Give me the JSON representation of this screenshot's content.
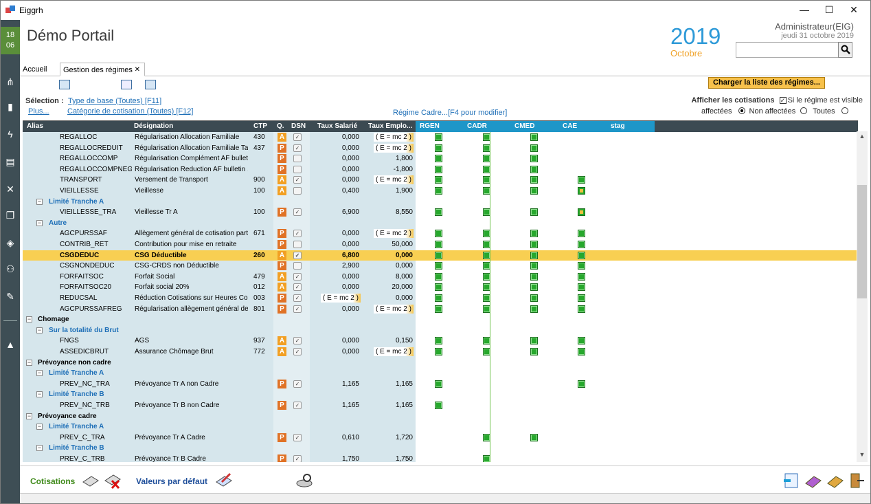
{
  "window": {
    "title": "Eiggrh",
    "minimize": "—",
    "maximize": "☐",
    "close": "✕"
  },
  "leftbar": {
    "day": "18",
    "month": "06",
    "icons": [
      "org-chart-icon",
      "user-icon",
      "flash-icon",
      "print-icon",
      "tools-icon",
      "copy-icon",
      "layers-icon",
      "group-icon",
      "edit-icon",
      "graduation-icon"
    ]
  },
  "header": {
    "app_title": "Démo Portail",
    "year": "2019",
    "month": "Octobre",
    "user": "Administrateur(EIG)",
    "date": "jeudi 31 octobre 2019",
    "search_value": ""
  },
  "tabs": {
    "home": "Accueil",
    "active": "Gestion des régimes",
    "close": "✕"
  },
  "toolbar": {
    "charger_label": "Charger la liste des régimes..."
  },
  "filters": {
    "selection_label": "Sélection :",
    "type_base": "Type de base (Toutes) [F11]",
    "plus": "Plus...",
    "categorie": "Catégorie de cotisation (Toutes) [F12]",
    "regime_cadre": "Régime Cadre...[F4 pour modifier]",
    "afficher_label": "Afficher les cotisations",
    "visible_label": "Si le régime est visible",
    "radio_affectees": "affectées",
    "radio_non": "Non affectées",
    "radio_toutes": "Toutes"
  },
  "grid": {
    "headers": {
      "alias": "Alias",
      "designation": "Désignation",
      "ctp": "CTP",
      "q": "Q.",
      "dsn": "DSN",
      "taux_sal": "Taux Salarié",
      "taux_emp": "Taux Emplo...",
      "rgen": "RGEN",
      "cadr": "CADR",
      "cmed": "CMED",
      "cae": "CAE",
      "stag": "stag"
    },
    "rows": [
      {
        "kind": "item",
        "alias": "REGALLOC",
        "desig": "Régularisation Allocation Familiale",
        "ctp": "430",
        "q": "A",
        "dsn": true,
        "ts": "0,000",
        "te": "( E = mc 2 )",
        "te_formula": true,
        "rgen": true,
        "cadr": true,
        "cmed": true,
        "cae": false
      },
      {
        "kind": "item",
        "alias": "REGALLOCREDUIT",
        "desig": "Régularisation Allocation Familiale Ta...",
        "ctp": "437",
        "q": "P",
        "dsn": true,
        "ts": "0,000",
        "te": "( E = mc 2 )",
        "te_formula": true,
        "rgen": true,
        "cadr": true,
        "cmed": true,
        "cae": false
      },
      {
        "kind": "item",
        "alias": "REGALLOCCOMP",
        "desig": "Régularisation Complément AF bulleti...",
        "ctp": "",
        "q": "P",
        "dsn": false,
        "ts": "0,000",
        "te": "1,800",
        "rgen": true,
        "cadr": true,
        "cmed": true,
        "cae": false
      },
      {
        "kind": "item",
        "alias": "REGALLOCCOMPNEG",
        "desig": "Régularisation Reduction AF bulletin ...",
        "ctp": "",
        "q": "P",
        "dsn": false,
        "ts": "0,000",
        "te": "-1,800",
        "rgen": true,
        "cadr": true,
        "cmed": true,
        "cae": false
      },
      {
        "kind": "item",
        "alias": "TRANSPORT",
        "desig": "Versement de Transport",
        "ctp": "900",
        "q": "A",
        "dsn": true,
        "ts": "0,000",
        "te": "( E = mc 2 )",
        "te_formula": true,
        "rgen": true,
        "cadr": true,
        "cmed": true,
        "cae": true
      },
      {
        "kind": "item",
        "alias": "VIEILLESSE",
        "desig": "Vieillesse",
        "ctp": "100",
        "q": "A",
        "dsn": false,
        "ts": "0,400",
        "te": "1,900",
        "rgen": true,
        "cadr": true,
        "cmed": true,
        "cae": "spec"
      },
      {
        "kind": "sub",
        "label": "Limité Tranche A"
      },
      {
        "kind": "item",
        "alias": "VIEILLESSE_TRA",
        "desig": "Vieillesse Tr A",
        "ctp": "100",
        "q": "P",
        "dsn": true,
        "ts": "6,900",
        "te": "8,550",
        "rgen": true,
        "cadr": true,
        "cmed": true,
        "cae": "spec"
      },
      {
        "kind": "sub",
        "label": "Autre"
      },
      {
        "kind": "item",
        "alias": "AGCPURSSAF",
        "desig": "Allègement général de cotisation part ...",
        "ctp": "671",
        "q": "P",
        "dsn": true,
        "ts": "0,000",
        "te": "( E = mc 2 )",
        "te_formula": true,
        "rgen": true,
        "cadr": true,
        "cmed": true,
        "cae": true
      },
      {
        "kind": "item",
        "alias": "CONTRIB_RET",
        "desig": "Contribution pour mise en retraite",
        "ctp": "",
        "q": "P",
        "dsn": false,
        "ts": "0,000",
        "te": "50,000",
        "rgen": true,
        "cadr": true,
        "cmed": true,
        "cae": true
      },
      {
        "kind": "item",
        "sel": true,
        "alias": "CSGDEDUC",
        "desig": "CSG Déductible",
        "ctp": "260",
        "q": "A",
        "dsn": true,
        "ts": "6,800",
        "te": "0,000",
        "rgen": true,
        "cadr": true,
        "cmed": true,
        "cae": true
      },
      {
        "kind": "item",
        "alias": "CSGNONDEDUC",
        "desig": "CSG-CRDS non Déductible",
        "ctp": "",
        "q": "P",
        "dsn": false,
        "ts": "2,900",
        "te": "0,000",
        "rgen": true,
        "cadr": true,
        "cmed": true,
        "cae": true
      },
      {
        "kind": "item",
        "alias": "FORFAITSOC",
        "desig": "Forfait Social",
        "ctp": "479",
        "q": "A",
        "dsn": true,
        "ts": "0,000",
        "te": "8,000",
        "rgen": true,
        "cadr": true,
        "cmed": true,
        "cae": true
      },
      {
        "kind": "item",
        "alias": "FORFAITSOC20",
        "desig": "Forfait social 20%",
        "ctp": "012",
        "q": "A",
        "dsn": true,
        "ts": "0,000",
        "te": "20,000",
        "rgen": true,
        "cadr": true,
        "cmed": true,
        "cae": true
      },
      {
        "kind": "item",
        "alias": "REDUCSAL",
        "desig": "Réduction Cotisations sur Heures Co...",
        "ctp": "003",
        "q": "P",
        "dsn": true,
        "ts": "( E = mc 2 )",
        "ts_formula": true,
        "te": "0,000",
        "rgen": true,
        "cadr": true,
        "cmed": true,
        "cae": true
      },
      {
        "kind": "item",
        "alias": "AGCPURSSAFREG",
        "desig": "Régularisation allègement général de ...",
        "ctp": "801",
        "q": "P",
        "dsn": true,
        "ts": "0,000",
        "te": "( E = mc 2 )",
        "te_formula": true,
        "rgen": true,
        "cadr": true,
        "cmed": true,
        "cae": true
      },
      {
        "kind": "grp",
        "label": "Chomage"
      },
      {
        "kind": "sub",
        "label": "Sur la totalité du Brut"
      },
      {
        "kind": "item",
        "alias": "FNGS",
        "desig": "AGS",
        "ctp": "937",
        "q": "A",
        "dsn": true,
        "ts": "0,000",
        "te": "0,150",
        "rgen": true,
        "cadr": true,
        "cmed": true,
        "cae": true
      },
      {
        "kind": "item",
        "alias": "ASSEDICBRUT",
        "desig": "Assurance Chômage Brut",
        "ctp": "772",
        "q": "A",
        "dsn": true,
        "ts": "0,000",
        "te": "( E = mc 2 )",
        "te_formula": true,
        "rgen": true,
        "cadr": true,
        "cmed": true,
        "cae": true
      },
      {
        "kind": "grp",
        "label": "Prévoyance non cadre"
      },
      {
        "kind": "sub",
        "label": "Limité Tranche A"
      },
      {
        "kind": "item",
        "alias": "PREV_NC_TRA",
        "desig": "Prévoyance Tr A non Cadre",
        "ctp": "",
        "q": "P",
        "dsn": true,
        "ts": "1,165",
        "te": "1,165",
        "rgen": true,
        "cadr": false,
        "cmed": false,
        "cae": true
      },
      {
        "kind": "sub",
        "label": "Limité Tranche B"
      },
      {
        "kind": "item",
        "alias": "PREV_NC_TRB",
        "desig": "Prévoyance Tr B non Cadre",
        "ctp": "",
        "q": "P",
        "dsn": true,
        "ts": "1,165",
        "te": "1,165",
        "rgen": true,
        "cadr": false,
        "cmed": false,
        "cae": false
      },
      {
        "kind": "grp",
        "label": "Prévoyance cadre"
      },
      {
        "kind": "sub",
        "label": "Limité Tranche A"
      },
      {
        "kind": "item",
        "alias": "PREV_C_TRA",
        "desig": "Prévoyance Tr A Cadre",
        "ctp": "",
        "q": "P",
        "dsn": true,
        "ts": "0,610",
        "te": "1,720",
        "rgen": false,
        "cadr": true,
        "cmed": true,
        "cae": false
      },
      {
        "kind": "sub",
        "label": "Limité Tranche B"
      },
      {
        "kind": "item",
        "alias": "PREV_C_TRB",
        "desig": "Prévoyance Tr B Cadre",
        "ctp": "",
        "q": "P",
        "dsn": true,
        "ts": "1,750",
        "te": "1,750",
        "rgen": false,
        "cadr": true,
        "cmed": false,
        "cae": false
      }
    ]
  },
  "bottom": {
    "cotisations": "Cotisations",
    "valeurs": "Valeurs par défaut"
  }
}
